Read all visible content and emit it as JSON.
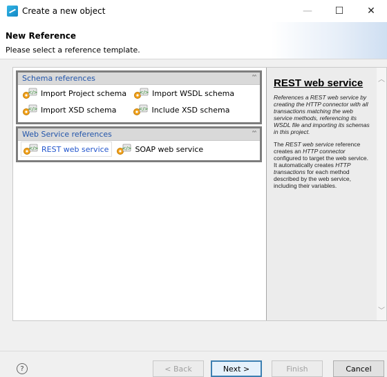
{
  "window": {
    "title": "Create a new object",
    "controls": {
      "minimize": "—",
      "maximize": "☐",
      "close": "✕"
    }
  },
  "header": {
    "title": "New Reference",
    "subtitle": "Please select a reference template."
  },
  "groups": [
    {
      "label": "Schema references",
      "collapse_icon": "double-chevron-up-icon",
      "rows": [
        [
          "Import Project schema",
          "Import WSDL schema"
        ],
        [
          "Import XSD schema",
          "Include XSD schema"
        ]
      ]
    },
    {
      "label": "Web Service references",
      "collapse_icon": "double-chevron-up-icon",
      "rows": [
        [
          "REST web service",
          "SOAP web service"
        ]
      ],
      "selected": "REST web service"
    }
  ],
  "description": {
    "title": "REST web service",
    "para1": "References a REST web service by creating the HTTP connector with all transactions matching the web service methods, referencing its WSDL file and importing its schemas in this project.",
    "para2_a": "The ",
    "para2_b": "REST web service",
    "para2_c": " reference creates an ",
    "para2_d": "HTTP connector",
    "para2_e": " configured to target the web service. It automatically creates ",
    "para2_f": "HTTP transactions",
    "para2_g": " for each method described by the web service, including their variables."
  },
  "footer": {
    "help": "?",
    "back": "< Back",
    "next": "Next >",
    "finish": "Finish",
    "cancel": "Cancel"
  },
  "colors": {
    "group_border": "#7d7d7d",
    "group_label": "#2255aa",
    "selected_text": "#2255cc",
    "default_button_border": "#3c7fb1"
  }
}
